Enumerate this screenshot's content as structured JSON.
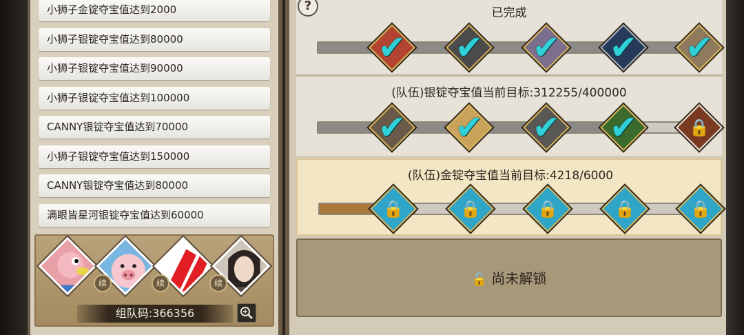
{
  "logs": [
    "小狮子金锭夺宝值达到2000",
    "小狮子银锭夺宝值达到80000",
    "小狮子银锭夺宝值达到90000",
    "小狮子银锭夺宝值达到100000",
    "CANNY银锭夺宝值达到70000",
    "小狮子银锭夺宝值达到150000",
    "CANNY银锭夺宝值达到80000",
    "满眼皆星河银锭夺宝值达到60000"
  ],
  "team": {
    "code_label": "组队码:366356",
    "badge_text": "续"
  },
  "help_symbol": "?",
  "section1": {
    "title": "已完成",
    "progress": 1.0
  },
  "section2": {
    "title": "(队伍)银锭夺宝值当前目标:312255/400000",
    "progress": 0.78
  },
  "section3": {
    "title": "(队伍)金锭夺宝值当前目标:4218/6000",
    "progress": 0.25
  },
  "section4": {
    "locked_label": "尚未解锁"
  },
  "colors": {
    "check": "#2fd0d8",
    "gold_fill": "#a9783a",
    "silver_fill": "#8c8a86",
    "chest_blue": "#2fa6c8"
  }
}
